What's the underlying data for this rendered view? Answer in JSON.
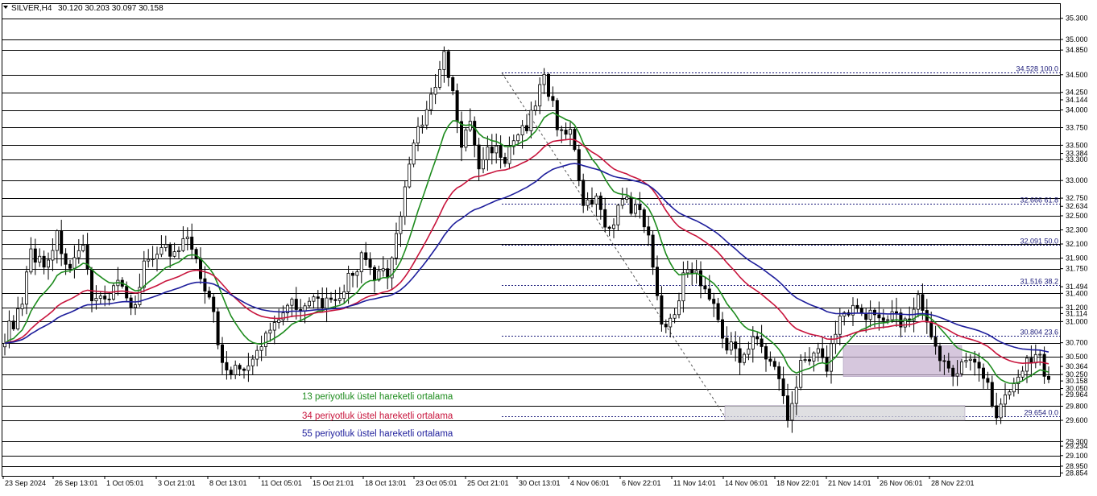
{
  "chart_data": {
    "type": "candlestick",
    "header": {
      "symbol": "SILVER,H4",
      "ohlc": "30.120 30.203 30.097 30.158"
    },
    "x_labels": [
      "23 Sep 2024",
      "26 Sep 13:01",
      "1 Oct 05:01",
      "3 Oct 21:01",
      "8 Oct 13:01",
      "11 Oct 05:01",
      "15 Oct 21:01",
      "18 Oct 13:01",
      "23 Oct 05:01",
      "25 Oct 21:01",
      "30 Oct 13:01",
      "4 Nov 06:01",
      "6 Nov 22:01",
      "11 Nov 14:01",
      "14 Nov 06:01",
      "18 Nov 22:01",
      "21 Nov 14:01",
      "26 Nov 06:01",
      "28 Nov 22:01"
    ],
    "y_labels": [
      "35.300",
      "35.000",
      "34.850",
      "34.500",
      "34.250",
      "34.144",
      "34.000",
      "33.750",
      "33.500",
      "33.384",
      "33.300",
      "33.000",
      "32.750",
      "32.634",
      "32.500",
      "32.300",
      "32.100",
      "31.900",
      "31.750",
      "31.494",
      "31.400",
      "31.200",
      "31.114",
      "31.000",
      "30.700",
      "30.500",
      "30.364",
      "30.250",
      "30.158",
      "30.050",
      "29.964",
      "29.800",
      "29.600",
      "29.234",
      "29.300",
      "29.100",
      "28.950",
      "28.854"
    ],
    "horizontal_levels": [
      35.3,
      35.0,
      34.85,
      34.5,
      34.25,
      34.0,
      33.75,
      33.5,
      33.3,
      33.0,
      32.75,
      32.5,
      32.3,
      32.1,
      31.9,
      31.75,
      31.4,
      31.2,
      31.0,
      30.7,
      30.5,
      30.25,
      30.05,
      29.8,
      29.6,
      29.3,
      29.1,
      28.95
    ],
    "fibonacci": {
      "levels": [
        {
          "value": 34.528,
          "label": "34.528 100.0"
        },
        {
          "value": 32.666,
          "label": "32.666 61.8"
        },
        {
          "value": 32.091,
          "label": "32.091 50.0"
        },
        {
          "value": 31.516,
          "label": "31.516 38.2"
        },
        {
          "value": 30.804,
          "label": "30.804 23.6"
        },
        {
          "value": 29.654,
          "label": "29.654 0.0"
        }
      ]
    },
    "zones": [
      {
        "from_label": "21 Nov 14:01",
        "to_label": "28 Nov 22:01",
        "top": 30.66,
        "bottom": 30.22,
        "color": "#c8b4d2"
      },
      {
        "from_label": "14 Nov 06:01",
        "to_label": "28 Nov 22:01",
        "top": 29.81,
        "bottom": 29.6,
        "color": "#d4d4d8"
      }
    ],
    "series": [
      {
        "name": "13 periyotluk üstel hareketli ortalama",
        "color": "#1e8c1e",
        "period": 13
      },
      {
        "name": "34 periyotluk üstel hareketli ortalama",
        "color": "#c8143c",
        "period": 34
      },
      {
        "name": "55 periyotluk üstel hareketli ortalama",
        "color": "#1e1e9c",
        "period": 55
      }
    ],
    "price_path": [
      [
        0,
        30.8
      ],
      [
        4,
        31.2
      ],
      [
        6,
        32.0
      ],
      [
        9,
        31.8
      ],
      [
        12,
        32.2
      ],
      [
        15,
        31.7
      ],
      [
        18,
        32.0
      ],
      [
        20,
        31.4
      ],
      [
        23,
        31.3
      ],
      [
        26,
        31.6
      ],
      [
        29,
        31.1
      ],
      [
        32,
        31.8
      ],
      [
        36,
        32.1
      ],
      [
        39,
        31.9
      ],
      [
        42,
        32.2
      ],
      [
        44,
        31.8
      ],
      [
        47,
        31.4
      ],
      [
        50,
        30.4
      ],
      [
        53,
        30.3
      ],
      [
        57,
        30.4
      ],
      [
        60,
        30.8
      ],
      [
        63,
        31.1
      ],
      [
        66,
        31.3
      ],
      [
        69,
        31.2
      ],
      [
        72,
        31.3
      ],
      [
        76,
        31.2
      ],
      [
        79,
        31.6
      ],
      [
        82,
        31.9
      ],
      [
        85,
        31.6
      ],
      [
        88,
        31.7
      ],
      [
        91,
        32.5
      ],
      [
        94,
        33.6
      ],
      [
        97,
        34.0
      ],
      [
        99,
        34.3
      ],
      [
        101,
        34.78
      ],
      [
        103,
        34.2
      ],
      [
        105,
        33.5
      ],
      [
        107,
        33.8
      ],
      [
        109,
        33.2
      ],
      [
        112,
        33.5
      ],
      [
        115,
        33.3
      ],
      [
        118,
        33.6
      ],
      [
        121,
        33.9
      ],
      [
        124,
        34.52
      ],
      [
        127,
        33.8
      ],
      [
        130,
        33.7
      ],
      [
        133,
        32.6
      ],
      [
        136,
        32.7
      ],
      [
        139,
        32.3
      ],
      [
        142,
        32.7
      ],
      [
        145,
        32.6
      ],
      [
        148,
        32.3
      ],
      [
        151,
        30.9
      ],
      [
        154,
        31.2
      ],
      [
        157,
        31.8
      ],
      [
        160,
        31.6
      ],
      [
        163,
        31.2
      ],
      [
        166,
        30.7
      ],
      [
        169,
        30.5
      ],
      [
        172,
        30.8
      ],
      [
        175,
        30.5
      ],
      [
        178,
        30.2
      ],
      [
        180,
        29.7
      ],
      [
        183,
        30.4
      ],
      [
        186,
        30.6
      ],
      [
        189,
        30.4
      ],
      [
        192,
        31.1
      ],
      [
        195,
        31.2
      ],
      [
        198,
        31.05
      ],
      [
        201,
        31.1
      ],
      [
        204,
        31.15
      ],
      [
        207,
        30.95
      ],
      [
        210,
        31.3
      ],
      [
        213,
        30.7
      ],
      [
        216,
        30.4
      ],
      [
        219,
        30.3
      ],
      [
        222,
        30.5
      ],
      [
        225,
        30.3
      ],
      [
        228,
        29.7
      ],
      [
        231,
        30.1
      ],
      [
        234,
        30.3
      ],
      [
        237,
        30.6
      ],
      [
        240,
        30.2
      ]
    ]
  },
  "legend": {
    "ema13": "13 periyotluk üstel hareketli ortalama",
    "ema34": "34 periyotluk üstel hareketli ortalama",
    "ema55": "55 periyotluk üstel hareketli ortalama"
  }
}
